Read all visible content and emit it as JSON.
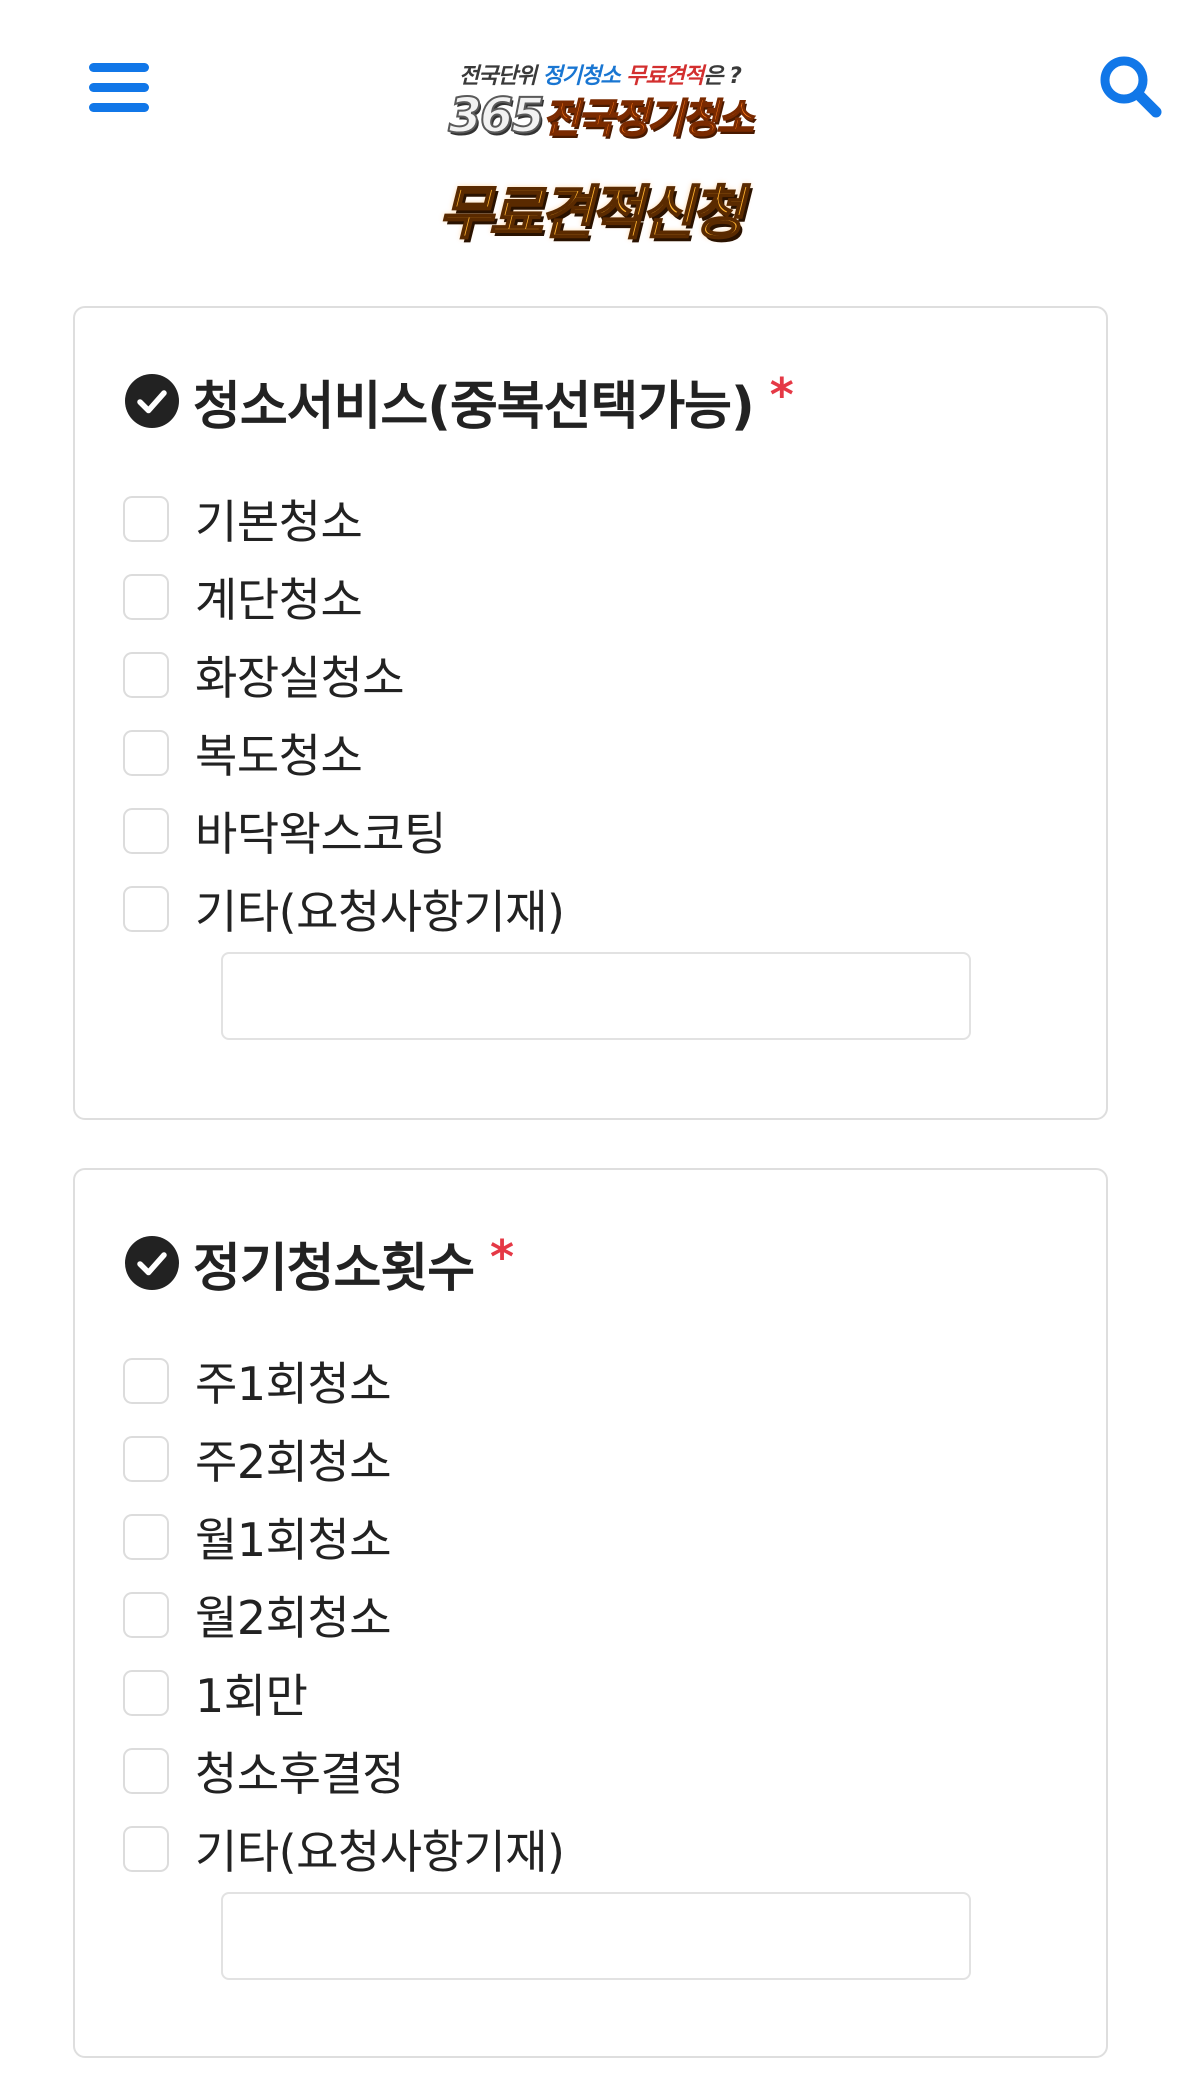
{
  "colors": {
    "accent_blue": "#1177e8",
    "required_red": "#e53946",
    "check_circle": "#222222",
    "card_border": "#dedede",
    "checkbox_border": "#dcdcdc"
  },
  "header": {
    "menu_icon": "hamburger-menu-icon",
    "search_icon": "search-icon",
    "logo": {
      "tagline_part1": "전국단위 ",
      "tagline_part2": "정기청소",
      "tagline_part3": " 무료견적",
      "tagline_part4": "은 ?",
      "brand_number": "365",
      "brand_name": "전국정기청소"
    },
    "cta_title": "무료견적신청"
  },
  "sections": [
    {
      "title": "청소서비스(중복선택가능)",
      "required_mark": "*",
      "options": [
        "기본청소",
        "계단청소",
        "화장실청소",
        "복도청소",
        "바닥왁스코팅",
        "기타(요청사항기재)"
      ],
      "etc_input_value": ""
    },
    {
      "title": "정기청소횟수",
      "required_mark": "*",
      "options": [
        "주1회청소",
        "주2회청소",
        "월1회청소",
        "월2회청소",
        "1회만",
        "청소후결정",
        "기타(요청사항기재)"
      ],
      "etc_input_value": ""
    }
  ]
}
